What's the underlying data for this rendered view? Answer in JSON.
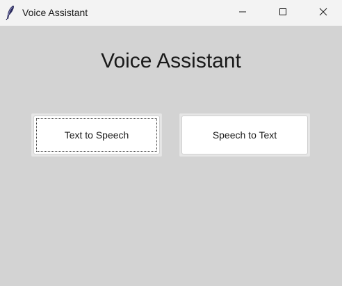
{
  "window": {
    "title": "Voice Assistant",
    "controls": {
      "minimize": "minimize-icon",
      "maximize": "maximize-icon",
      "close": "close-icon"
    },
    "icon": "feather-icon"
  },
  "main": {
    "heading": "Voice Assistant",
    "buttons": [
      {
        "label": "Text to Speech",
        "focused": true
      },
      {
        "label": "Speech to Text",
        "focused": false
      }
    ]
  },
  "colors": {
    "background": "#d3d3d3",
    "titlebar": "#f3f3f3",
    "button": "#ffffff"
  }
}
